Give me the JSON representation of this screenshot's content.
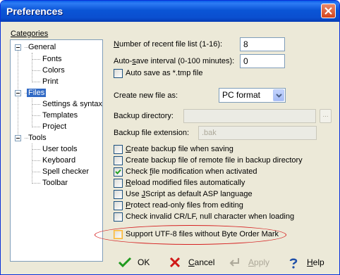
{
  "window": {
    "title": "Preferences"
  },
  "categories": {
    "label": "Categories",
    "general": {
      "label": "General",
      "children": [
        "Fonts",
        "Colors",
        "Print"
      ]
    },
    "files": {
      "label": "Files",
      "children": [
        "Settings & syntax",
        "Templates",
        "Project"
      ]
    },
    "tools": {
      "label": "Tools",
      "children": [
        "User tools",
        "Keyboard",
        "Spell checker",
        "Toolbar"
      ]
    }
  },
  "files_page": {
    "recent_files": {
      "label_pre": "",
      "label_u": "N",
      "label_post": "umber of recent file list (1-16):",
      "value": "8"
    },
    "autosave": {
      "label_pre": "Auto-",
      "label_u": "s",
      "label_post": "ave interval (0-100 minutes):",
      "value": "0"
    },
    "autosave_tmp": {
      "label": "Auto save as *.tmp file",
      "checked": false
    },
    "create_new": {
      "label": "Create new file as:",
      "value": "PC format"
    },
    "backup_dir": {
      "label": "Backup directory:",
      "value": "",
      "browse": "..."
    },
    "backup_ext": {
      "label": "Backup file extension:",
      "value": ".bak"
    },
    "options": [
      {
        "pre": "",
        "u": "C",
        "post": "reate backup file when saving",
        "checked": false,
        "highlight": false
      },
      {
        "pre": "Create backup file of remote file in backup directory",
        "u": "",
        "post": "",
        "checked": false,
        "highlight": false
      },
      {
        "pre": "Check ",
        "u": "f",
        "post": "ile modification when activated",
        "checked": true,
        "highlight": false
      },
      {
        "pre": "",
        "u": "R",
        "post": "eload modified files automatically",
        "checked": false,
        "highlight": false
      },
      {
        "pre": "Use ",
        "u": "J",
        "post": "Script as default ASP language",
        "checked": false,
        "highlight": false
      },
      {
        "pre": "",
        "u": "P",
        "post": "rotect read-only files from editing",
        "checked": false,
        "highlight": false
      },
      {
        "pre": "Check invalid CR/LF, null character when loading",
        "u": "",
        "post": "",
        "checked": false,
        "highlight": false
      },
      {
        "pre": "Support UTF-8 files without Byte Order Mark",
        "u": "",
        "post": "",
        "checked": false,
        "highlight": true
      }
    ]
  },
  "buttons": {
    "ok": "OK",
    "cancel_u": "C",
    "cancel_post": "ancel",
    "apply_u": "A",
    "apply_post": "pply",
    "help_u": "H",
    "help_post": "elp"
  },
  "colors": {
    "annotation": "#d62020",
    "selection": "#316ac5",
    "titlebar": "#0a55d6"
  }
}
